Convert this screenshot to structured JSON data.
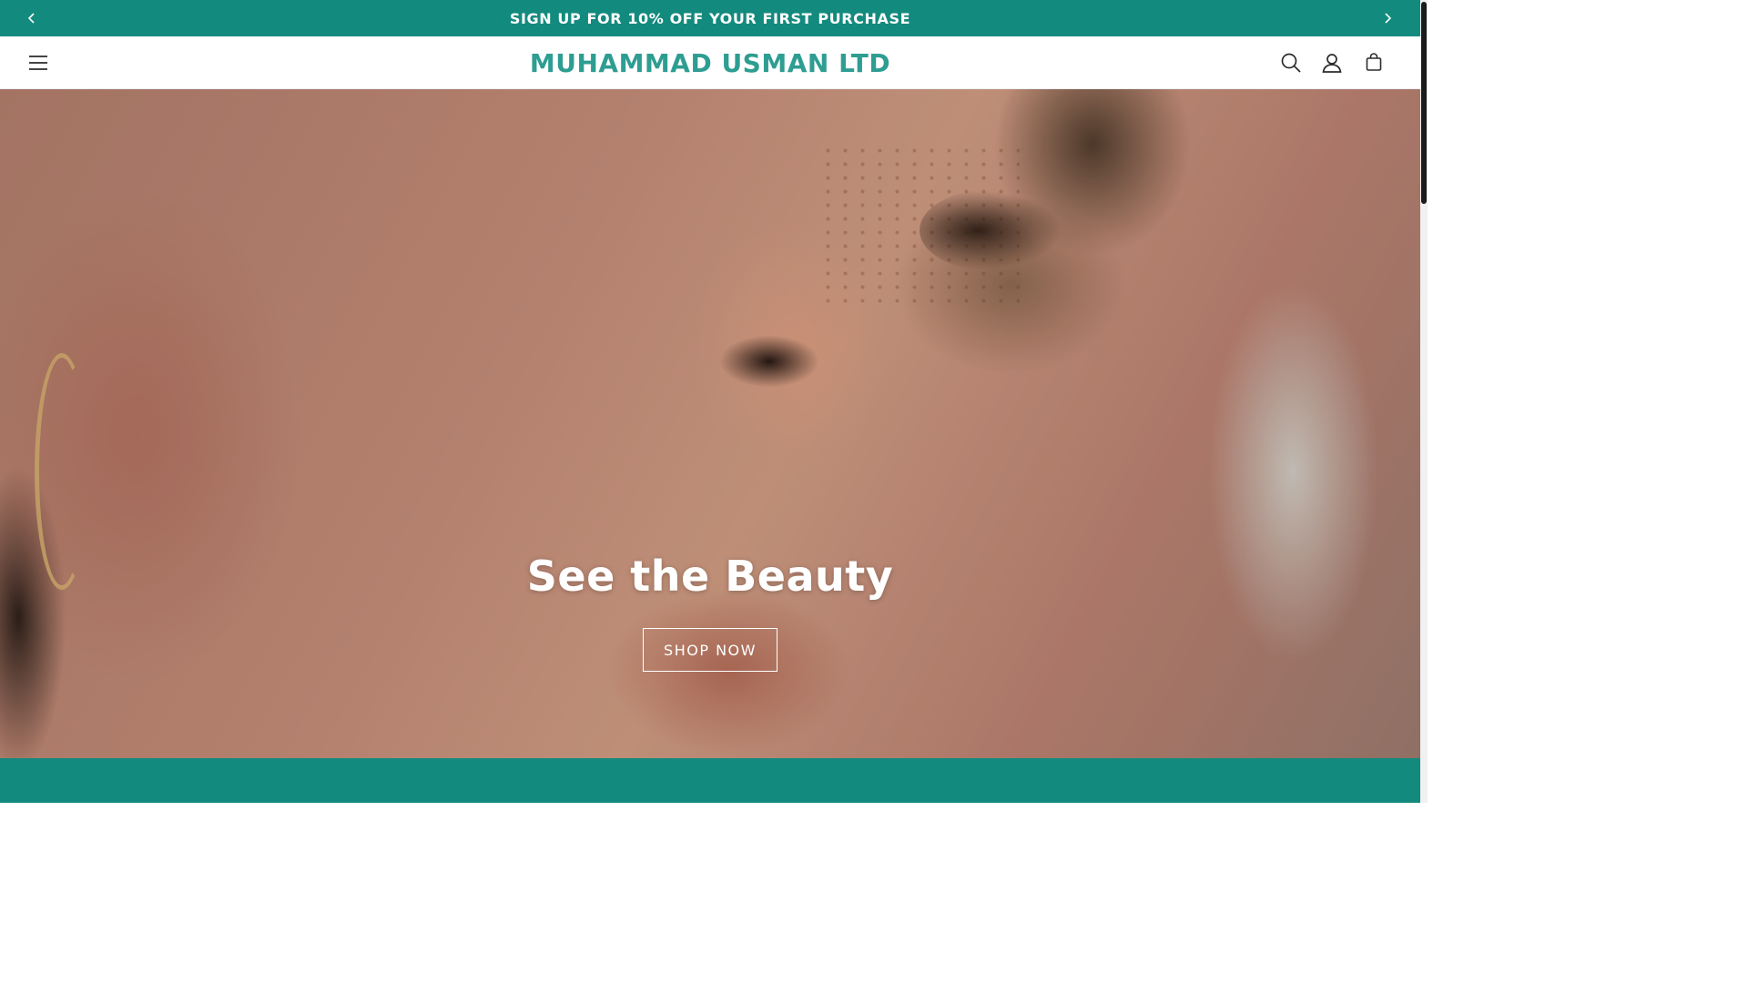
{
  "announcement": {
    "text": "SIGN UP FOR 10% OFF YOUR FIRST PURCHASE",
    "prev_icon": "chevron-left-icon",
    "next_icon": "chevron-right-icon"
  },
  "header": {
    "logo": "MUHAMMAD USMAN LTD",
    "menu_icon": "hamburger-menu-icon",
    "icons": [
      "search-icon",
      "account-icon",
      "cart-icon"
    ]
  },
  "hero": {
    "title": "See the Beauty",
    "button_label": "SHOP NOW"
  },
  "colors": {
    "brand": "#138a7e",
    "logo": "#2e9d92",
    "white": "#ffffff"
  }
}
